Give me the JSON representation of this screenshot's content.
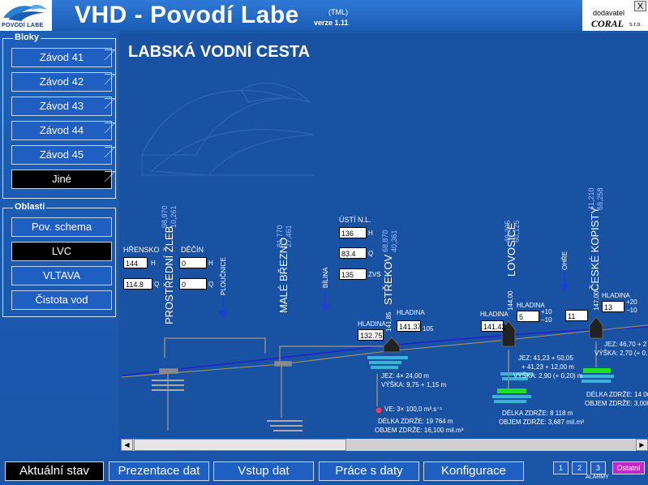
{
  "header": {
    "logo_text": "POVODÍ LABE",
    "title": "VHD - Povodí Labe",
    "tml": "(TML)",
    "version": "verze 1.11",
    "vendor_label": "dodavatel",
    "vendor_name": "CORAL",
    "vendor_suffix": "s.r.o.",
    "close_label": "X"
  },
  "sidebar": {
    "bloky_title": "Bloky",
    "bloky": [
      {
        "label": "Závod 41"
      },
      {
        "label": "Závod 42"
      },
      {
        "label": "Závod 43"
      },
      {
        "label": "Závod 44"
      },
      {
        "label": "Závod 45"
      },
      {
        "label": "Jiné"
      }
    ],
    "oblasti_title": "Oblasti",
    "oblasti": [
      {
        "label": "Pov. schema"
      },
      {
        "label": "LVC"
      },
      {
        "label": "VLTAVA"
      },
      {
        "label": "Čistota vod"
      }
    ]
  },
  "main": {
    "title": "LABSKÁ VODNÍ CESTA",
    "hrensko": {
      "label": "HŘENSKO",
      "h": "144",
      "h_unit": "H",
      "q": "114.8",
      "q_unit": "Q"
    },
    "decin": {
      "label": "DĚČÍN",
      "h": "0",
      "h_unit": "H",
      "q": "0",
      "q_unit": "Q"
    },
    "usti": {
      "label": "ÚSTÍ N.L.",
      "h": "136",
      "h_unit": "H",
      "q": "83.4",
      "q_unit": "Q",
      "zvs": "135",
      "zvs_unit": "ZVS"
    },
    "stations": [
      {
        "name": "PROSTŘEDNÍ ŽLEB",
        "km1": "98,970",
        "km2": "10,261"
      },
      {
        "name": "MALÉ BŘEZNO",
        "km1": "81,770",
        "km2": "27,461"
      },
      {
        "name": "STŘEKOV",
        "km1": "68,870",
        "km2": "40,361"
      },
      {
        "name": "LOVOSICE",
        "km1": "49,295",
        "km2": "60,125"
      },
      {
        "name": "ČESKÉ KOPISTY",
        "km1": "41,210",
        "km2": "68,258"
      }
    ],
    "tributaries": {
      "ploucnice": "PLOUČNICE",
      "bilina": "BÍLINA",
      "ohre": "OHŘE"
    },
    "strekov": {
      "hladina_label": "HLADINA",
      "hladina_low": "132.75",
      "hladina2_label": "HLADINA",
      "hladina_high": "141.37",
      "elev": "141,85",
      "mark": "105",
      "jez": "JEZ: 4× 24,00 m",
      "vyska": "VÝŠKA: 9,75 + 1,15 m",
      "ve": "VE: 3× 100,0 m³.s⁻¹",
      "delka": "DÉLKA ZDRŽE: 19 764 m",
      "objem": "OBJEM ZDRŽE: 16,100 mil.m³"
    },
    "lovosice": {
      "hladina_label": "HLADINA",
      "hladina_low": "141.42",
      "hladina2_label": "HLADINA",
      "hladina_high": "5",
      "elev": "144,00",
      "plus": "+10",
      "minus": "−10",
      "jez1": "JEZ: 41,23 + 50,05",
      "jez2": "+ 41,23 + 12,00 m",
      "vyska": "VÝŠKA: 2,90 (+ 0,20) m",
      "delka": "DÉLKA ZDRŽE: 8 118 m",
      "objem": "OBJEM ZDRŽE: 3,687 mil.m³"
    },
    "kopisty": {
      "hladina_low": "11",
      "hladina2_label": "HLADINA",
      "hladina_high": "13",
      "elev": "147,00",
      "plus": "+20",
      "minus": "−10",
      "jez": "JEZ: 46,70 + 2",
      "vyska": "VÝŠKA: 2,70 (+ 0,",
      "delka": "DÉLKA ZDRŽE: 14 06",
      "objem": "OBJEM ZDRŽE: 3,000"
    }
  },
  "scrollbar": {
    "left_arrow": "◀",
    "right_arrow": "▶"
  },
  "bottom_nav": [
    {
      "label": "Aktuální stav"
    },
    {
      "label": "Prezentace dat"
    },
    {
      "label": "Vstup dat"
    },
    {
      "label": "Práce s daty"
    },
    {
      "label": "Konfigurace"
    }
  ],
  "alarms": {
    "b1": "1",
    "b2": "2",
    "b3": "3",
    "other": "Ostatní",
    "label": "ALARMY"
  },
  "colors": {
    "background": "#1a55a8",
    "panel": "#1951a3",
    "active": "#000000",
    "alarm_other": "#c326c8",
    "water_green": "#22dd22"
  }
}
